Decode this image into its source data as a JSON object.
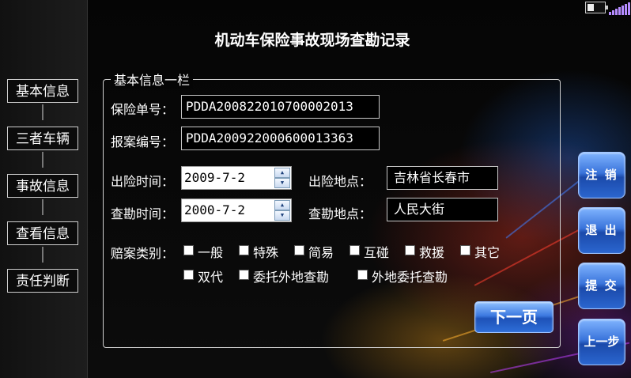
{
  "title": "机动车保险事故现场查勘记录",
  "nav": {
    "items": [
      "基本信息",
      "三者车辆",
      "事故信息",
      "查看信息",
      "责任判断"
    ]
  },
  "form": {
    "group_title": "基本信息一栏",
    "policy_label": "保险单号：",
    "policy_value": "PDDA200822010700002013",
    "report_label": "报案编号：",
    "report_value": "PDDA200922000600013363",
    "accident_time_label": "出险时间：",
    "accident_time_value": "2009-7-2",
    "accident_place_label": "出险地点：",
    "accident_place_value": "吉林省长春市",
    "survey_time_label": "查勘时间：",
    "survey_time_value": "2000-7-2",
    "survey_place_label": "查勘地点：",
    "survey_place_value": "人民大街",
    "claim_type_label": "赔案类别：",
    "claim_types": [
      "一般",
      "特殊",
      "简易",
      "互碰",
      "救援",
      "其它",
      "双代",
      "委托外地查勘",
      "外地委托查勘"
    ],
    "next_button": "下一页"
  },
  "side_buttons": {
    "logout": "注 销",
    "exit": "退 出",
    "submit": "提 交",
    "prev": "上一步"
  },
  "status": {
    "battery_icon": "battery-icon",
    "signal_icon": "signal-icon"
  }
}
